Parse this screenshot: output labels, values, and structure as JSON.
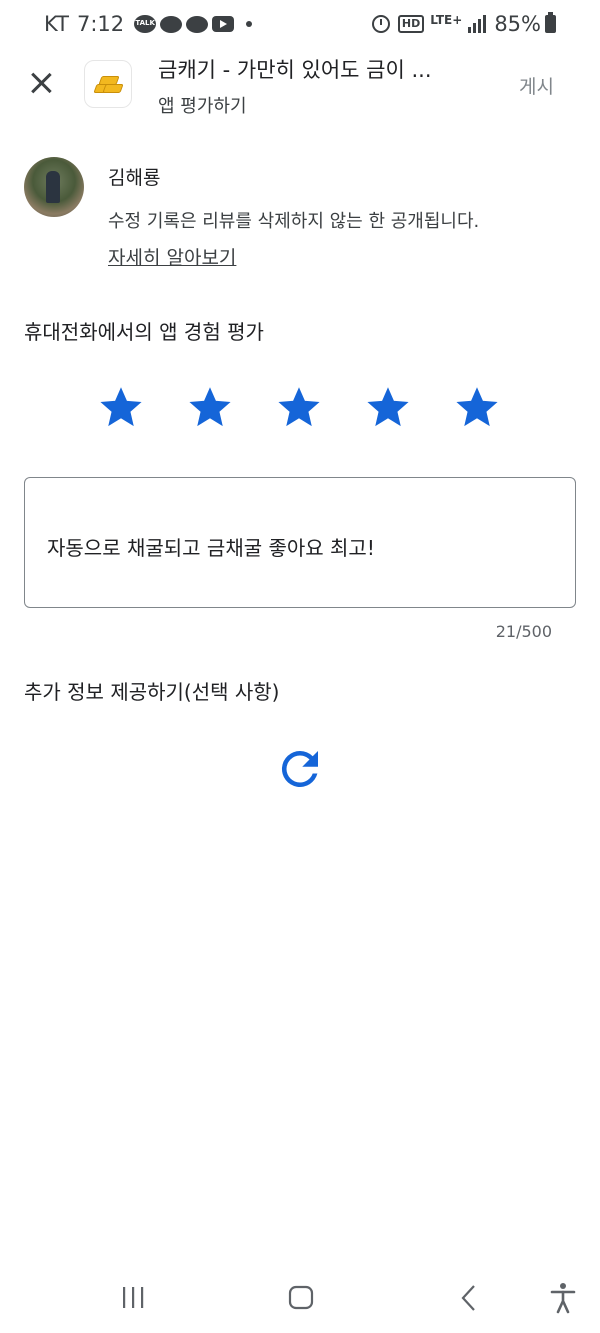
{
  "status_bar": {
    "carrier": "KT",
    "time": "7:12",
    "talk_label": "TALK",
    "hd_label": "HD",
    "lte_label": "LTE+",
    "battery": "85%"
  },
  "header": {
    "app_title": "금캐기 - 가만히 있어도 금이 ...",
    "subtitle": "앱 평가하기",
    "post_label": "게시"
  },
  "user": {
    "name": "김해룡",
    "notice": "수정 기록은 리뷰를 삭제하지 않는 한 공개됩니다.",
    "learn_more": "자세히 알아보기"
  },
  "rating": {
    "heading": "휴대전화에서의 앱 경험 평가",
    "stars_filled": 5,
    "stars_total": 5,
    "star_color": "#1565d8"
  },
  "review": {
    "text": "자동으로 채굴되고 금채굴 좋아요 최고!",
    "char_count": "21/500"
  },
  "extra": {
    "heading": "추가 정보 제공하기(선택 사항)",
    "refresh_color": "#1565d8"
  },
  "nav": {
    "icons": [
      "recents-icon",
      "home-icon",
      "back-icon",
      "accessibility-icon"
    ]
  }
}
